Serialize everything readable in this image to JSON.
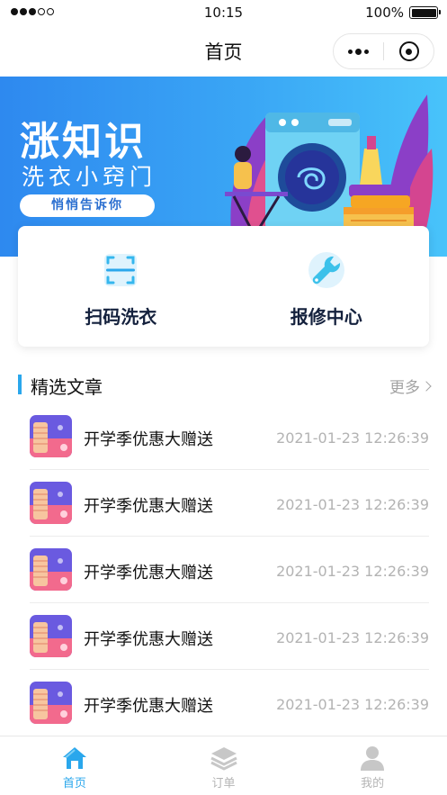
{
  "status_bar": {
    "time": "10:15",
    "battery": "100%"
  },
  "nav": {
    "title": "首页",
    "capsule_icons": [
      "more-dots-icon",
      "close-target-icon"
    ]
  },
  "banner": {
    "title": "涨知识",
    "subtitle": "洗衣小窍门",
    "pill": "悄悄告诉你"
  },
  "features": [
    {
      "label": "扫码洗衣",
      "icon": "scan-icon"
    },
    {
      "label": "报修中心",
      "icon": "wrench-icon"
    }
  ],
  "section": {
    "title": "精选文章",
    "more": "更多"
  },
  "articles": [
    {
      "title": "开学季优惠大赠送",
      "date": "2021-01-23 12:26:39"
    },
    {
      "title": "开学季优惠大赠送",
      "date": "2021-01-23 12:26:39"
    },
    {
      "title": "开学季优惠大赠送",
      "date": "2021-01-23 12:26:39"
    },
    {
      "title": "开学季优惠大赠送",
      "date": "2021-01-23 12:26:39"
    },
    {
      "title": "开学季优惠大赠送",
      "date": "2021-01-23 12:26:39"
    }
  ],
  "tabs": [
    {
      "label": "首页",
      "icon": "home-icon",
      "active": true
    },
    {
      "label": "订单",
      "icon": "layers-icon",
      "active": false
    },
    {
      "label": "我的",
      "icon": "user-icon",
      "active": false
    }
  ],
  "colors": {
    "accent": "#2aa7ec",
    "banner_start": "#2e89ef",
    "banner_end": "#48c3fa",
    "text_dark": "#14213d",
    "muted": "#b3b3b3"
  }
}
